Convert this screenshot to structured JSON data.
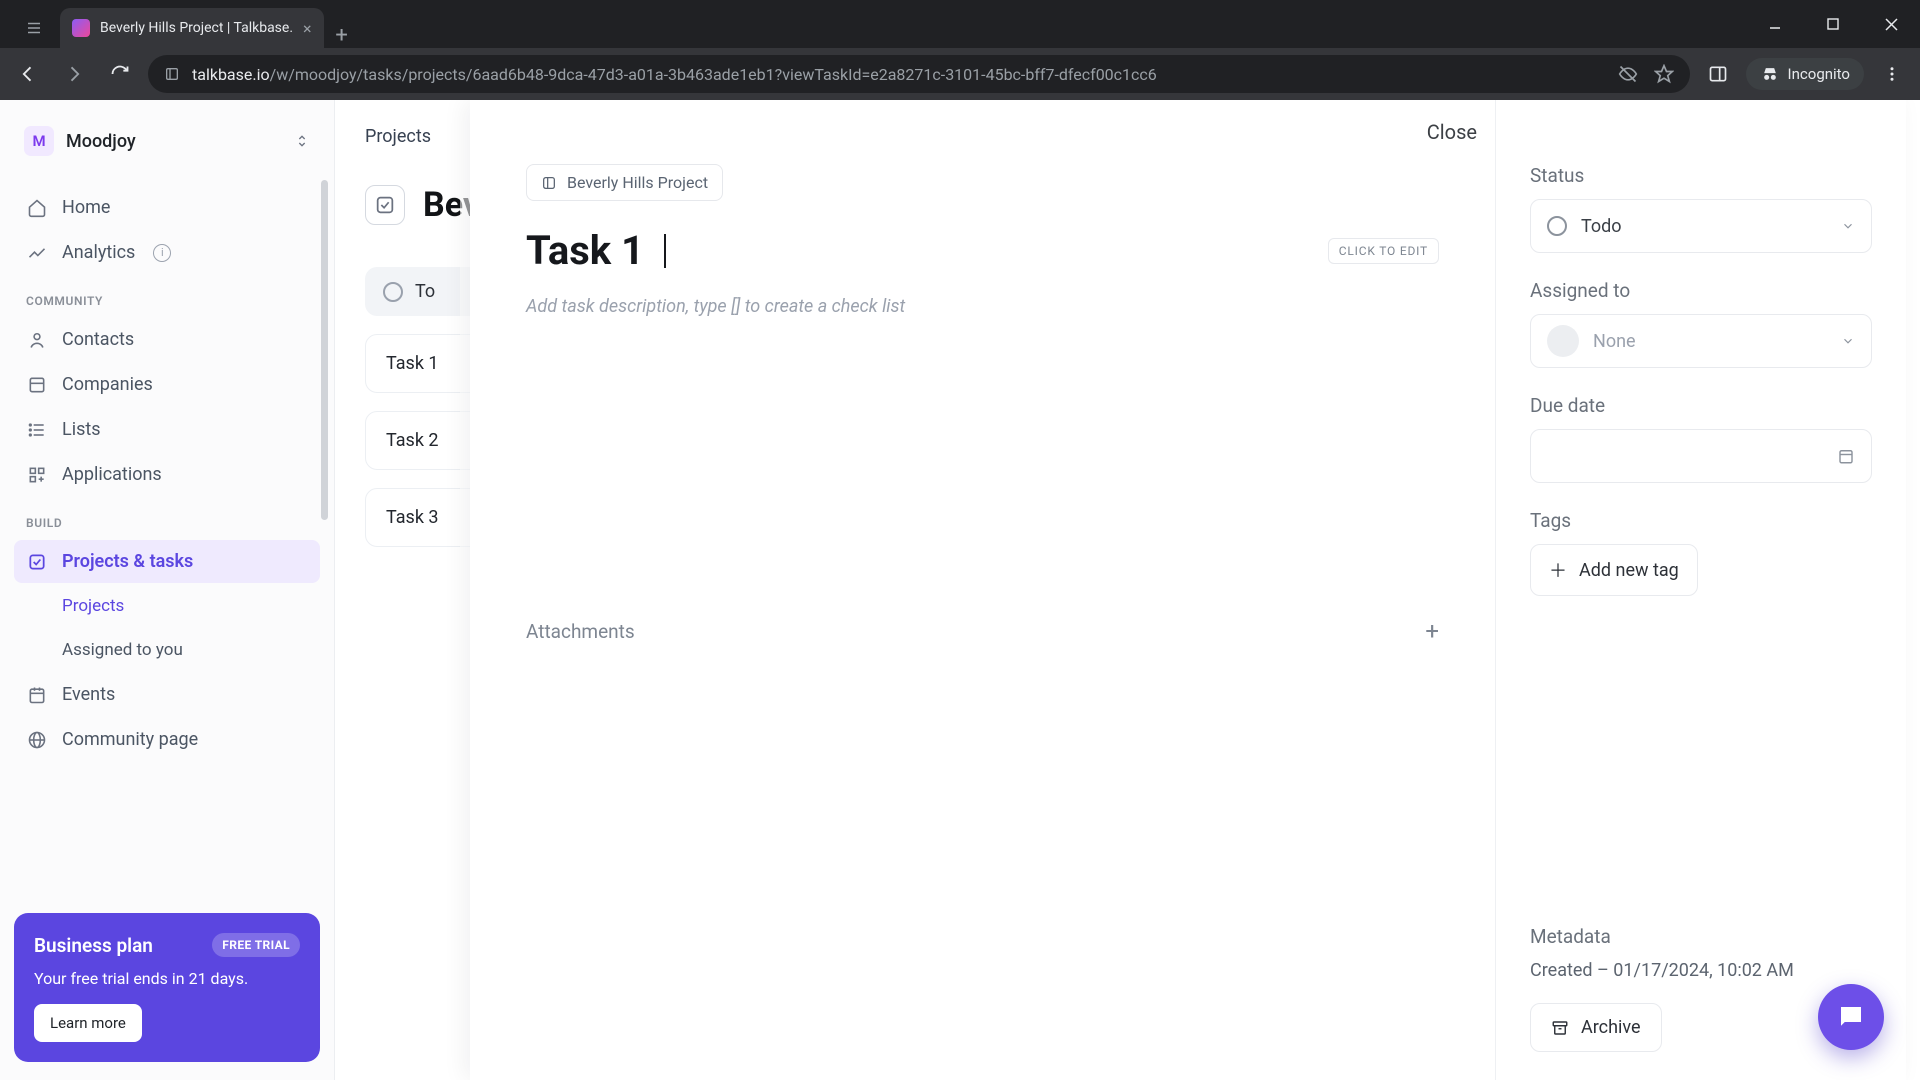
{
  "browser": {
    "tab_title": "Beverly Hills Project | Talkbase.",
    "url_domain": "talkbase.io",
    "url_path": "/w/moodjoy/tasks/projects/6aad6b48-9dca-47d3-a01a-3b463ade1eb1?viewTaskId=e2a8271c-3101-45bc-bff7-dfecf00c1cc6",
    "incognito_label": "Incognito"
  },
  "workspace": {
    "initial": "M",
    "name": "Moodjoy"
  },
  "nav": {
    "home": "Home",
    "analytics": "Analytics",
    "section_community": "COMMUNITY",
    "contacts": "Contacts",
    "companies": "Companies",
    "lists": "Lists",
    "applications": "Applications",
    "section_build": "BUILD",
    "projects_tasks": "Projects & tasks",
    "projects": "Projects",
    "assigned": "Assigned to you",
    "events": "Events",
    "community_page": "Community page"
  },
  "trial": {
    "plan": "Business plan",
    "badge": "FREE TRIAL",
    "line": "Your free trial ends in 21 days.",
    "cta": "Learn more"
  },
  "bg": {
    "breadcrumb": "Projects",
    "project_title_partial": "Bever",
    "col_todo_partial": "To",
    "tasks": [
      "Task 1",
      "Task 2",
      "Task 3"
    ]
  },
  "task": {
    "close": "Close",
    "chip": "Beverly Hills Project",
    "title": "Task 1",
    "click_to_edit": "CLICK TO EDIT",
    "desc_placeholder": "Add task description, type [] to create a check list",
    "attachments": "Attachments",
    "status_label": "Status",
    "status_value": "Todo",
    "assigned_label": "Assigned to",
    "assigned_value": "None",
    "due_label": "Due date",
    "tags_label": "Tags",
    "add_tag": "Add new tag",
    "metadata_label": "Metadata",
    "metadata_value": "Created – 01/17/2024, 10:02 AM",
    "archive": "Archive"
  }
}
